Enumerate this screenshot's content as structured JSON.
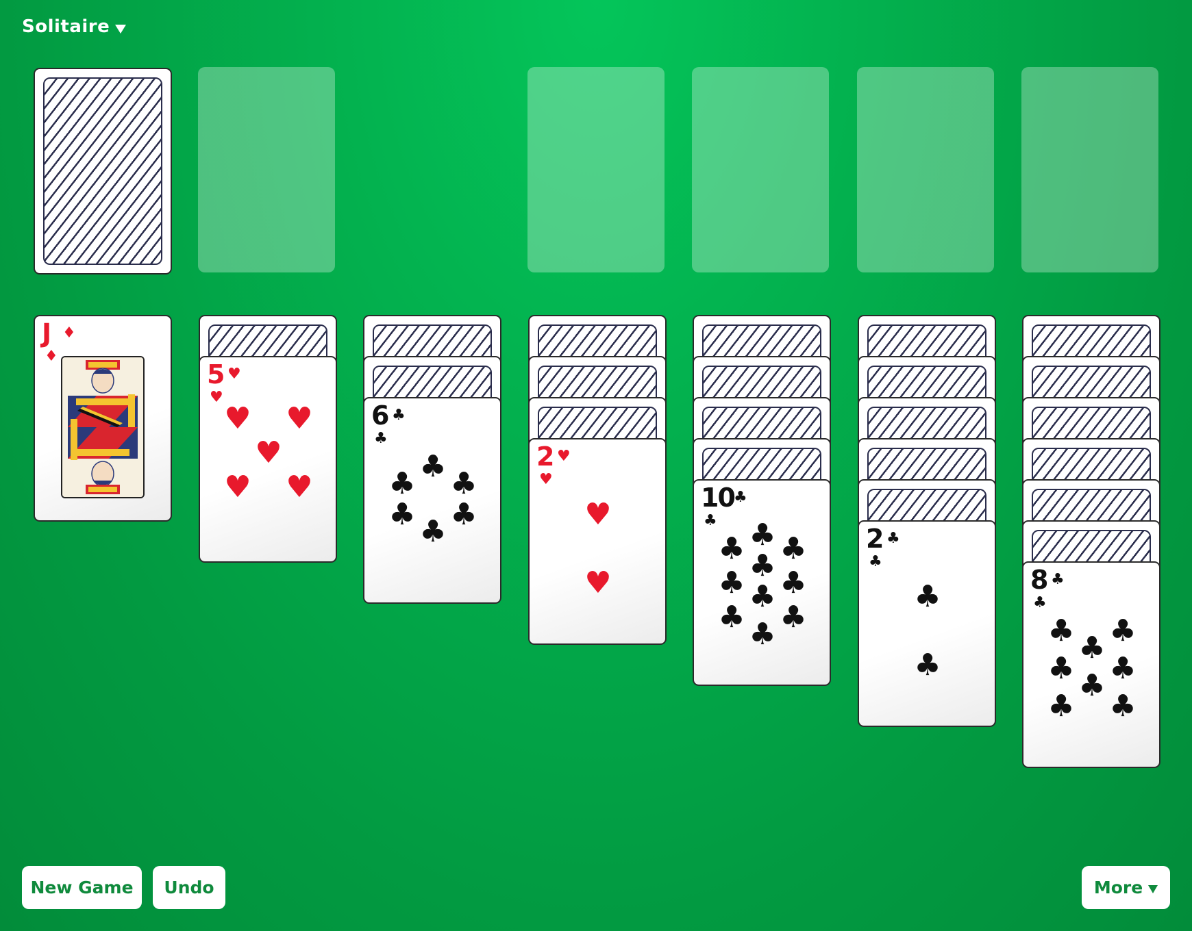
{
  "header": {
    "game_menu_label": "Solitaire"
  },
  "buttons": {
    "new_game": "New Game",
    "undo": "Undo",
    "more": "More"
  },
  "colors": {
    "felt": "#03b24f",
    "red_suit": "#e8192c",
    "black_suit": "#111111",
    "button_text": "#0f8a3c"
  },
  "stock": {
    "face_down": true
  },
  "waste": {
    "empty": true
  },
  "foundations": [
    {
      "empty": true
    },
    {
      "empty": true
    },
    {
      "empty": true
    },
    {
      "empty": true
    }
  ],
  "tableau": [
    {
      "face_down_count": 0,
      "top_card": {
        "rank": "J",
        "suit": "♦",
        "color": "red"
      }
    },
    {
      "face_down_count": 1,
      "top_card": {
        "rank": "5",
        "suit": "♥",
        "color": "red"
      }
    },
    {
      "face_down_count": 2,
      "top_card": {
        "rank": "6",
        "suit": "♣",
        "color": "black"
      }
    },
    {
      "face_down_count": 3,
      "top_card": {
        "rank": "2",
        "suit": "♥",
        "color": "red"
      }
    },
    {
      "face_down_count": 4,
      "top_card": {
        "rank": "10",
        "suit": "♣",
        "color": "black"
      }
    },
    {
      "face_down_count": 5,
      "top_card": {
        "rank": "2",
        "suit": "♣",
        "color": "black"
      }
    },
    {
      "face_down_count": 6,
      "top_card": {
        "rank": "8",
        "suit": "♣",
        "color": "black"
      }
    }
  ]
}
